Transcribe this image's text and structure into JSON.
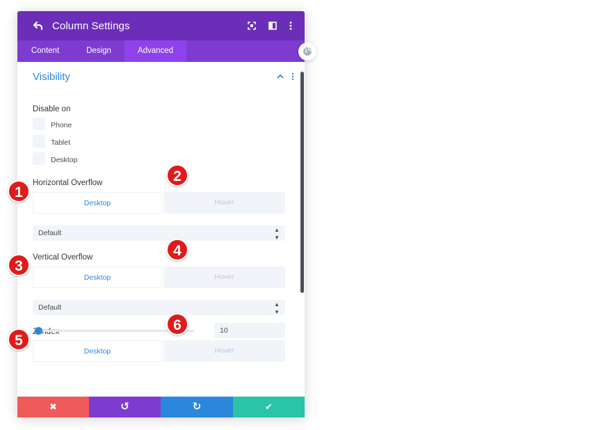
{
  "header": {
    "title": "Column Settings"
  },
  "tabs": [
    {
      "label": "Content"
    },
    {
      "label": "Design"
    },
    {
      "label": "Advanced"
    }
  ],
  "section": {
    "title": "Visibility"
  },
  "disable_on": {
    "label": "Disable on",
    "options": [
      {
        "label": "Phone"
      },
      {
        "label": "Tablet"
      },
      {
        "label": "Desktop"
      }
    ]
  },
  "horizontal_overflow": {
    "label": "Horizontal Overflow",
    "desktop_label": "Desktop",
    "hover_label": "Hover",
    "value": "Default"
  },
  "vertical_overflow": {
    "label": "Vertical Overflow",
    "desktop_label": "Desktop",
    "hover_label": "Hover",
    "value": "Default"
  },
  "z_index": {
    "label": "Z Index",
    "desktop_label": "Desktop",
    "hover_label": "Hover",
    "value": "10"
  },
  "badges": [
    "1",
    "2",
    "3",
    "4",
    "5",
    "6"
  ],
  "colors": {
    "header": "#6c2eb9",
    "tabs": "#7e3bd0",
    "accent": "#2b87da",
    "cancel": "#ef5a5a",
    "undo": "#7e3bd0",
    "redo": "#2b87da",
    "save": "#29c4a9",
    "badge": "#e01b1b"
  },
  "icons": {
    "back": "undo-arrow-icon",
    "focus": "focus-icon",
    "split": "split-view-icon",
    "more": "more-vertical-icon",
    "collapse": "chevron-up-icon",
    "world": "globe-icon"
  },
  "footer": {
    "cancel": "✖",
    "undo": "↺",
    "redo": "↻",
    "save": "✔"
  }
}
